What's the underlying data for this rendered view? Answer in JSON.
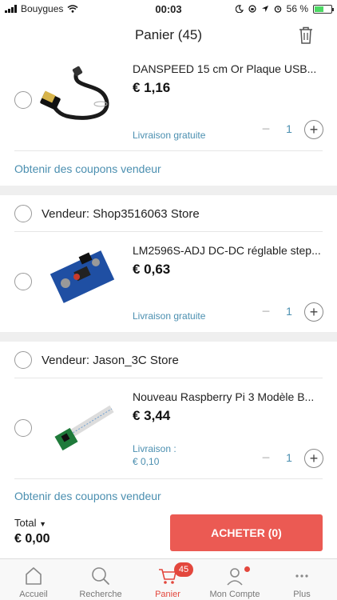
{
  "status_bar": {
    "carrier": "Bouygues",
    "time": "00:03",
    "battery": "56 %",
    "battery_level": 0.56
  },
  "header": {
    "title": "Panier (45)"
  },
  "items": [
    {
      "name": "DANSPEED 15 cm Or Plaque USB...",
      "price": "€ 1,16",
      "shipping": "Livraison gratuite",
      "quantity": "1"
    },
    {
      "name": "LM2596S-ADJ DC-DC réglable step...",
      "price": "€ 0,63",
      "shipping": "Livraison gratuite",
      "quantity": "1"
    },
    {
      "name": "Nouveau Raspberry Pi 3 Modèle B...",
      "price": "€ 3,44",
      "shipping_line1": "Livraison :",
      "shipping_line2": "€ 0,10",
      "quantity": "1"
    }
  ],
  "vendors": [
    "Vendeur: Shop3516063 Store",
    "Vendeur: Jason_3C Store"
  ],
  "coupon_label": "Obtenir des coupons vendeur",
  "footer": {
    "total_label": "Total",
    "total_value": "€ 0,00",
    "buy_label": "ACHETER (0)"
  },
  "tabs": [
    {
      "label": "Accueil",
      "icon": "home-icon"
    },
    {
      "label": "Recherche",
      "icon": "search-icon"
    },
    {
      "label": "Panier",
      "icon": "cart-icon",
      "badge": "45"
    },
    {
      "label": "Mon Compte",
      "icon": "person-icon"
    },
    {
      "label": "Plus",
      "icon": "more-icon"
    }
  ],
  "colors": {
    "accent": "#e3473d",
    "buy_button": "#eb5a53",
    "link": "#4b8fb0"
  }
}
